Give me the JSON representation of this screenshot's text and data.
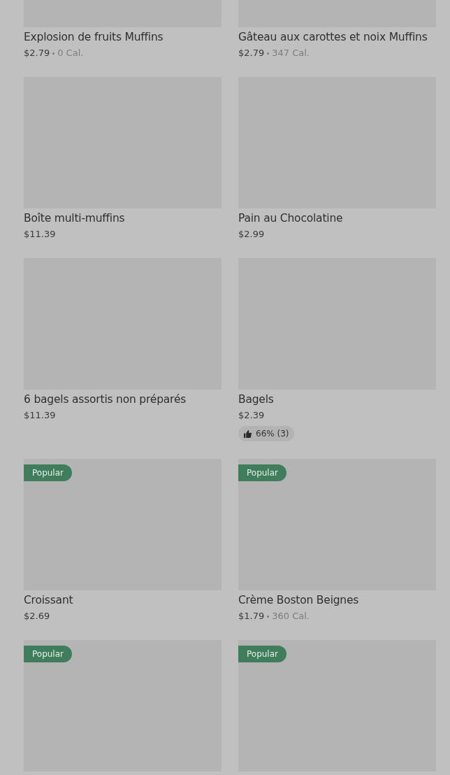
{
  "items": [
    {
      "name": "Explosion de fruits Muffins",
      "price": "$2.79",
      "calories": "0 Cal."
    },
    {
      "name": "Gâteau aux carottes et noix Muffins",
      "price": "$2.79",
      "calories": "347 Cal."
    },
    {
      "name": "Boîte multi-muffins",
      "price": "$11.39"
    },
    {
      "name": "Pain au Chocolatine",
      "price": "$2.99"
    },
    {
      "name": "6 bagels assortis non préparés",
      "price": "$11.39"
    },
    {
      "name": "Bagels",
      "price": "$2.39",
      "rating": "66% (3)"
    },
    {
      "name": "Croissant",
      "price": "$2.69",
      "badge": "Popular"
    },
    {
      "name": "Crème Boston Beignes",
      "price": "$1.79",
      "calories": "360 Cal.",
      "badge": "Popular"
    },
    {
      "badge": "Popular"
    },
    {
      "badge": "Popular"
    }
  ]
}
